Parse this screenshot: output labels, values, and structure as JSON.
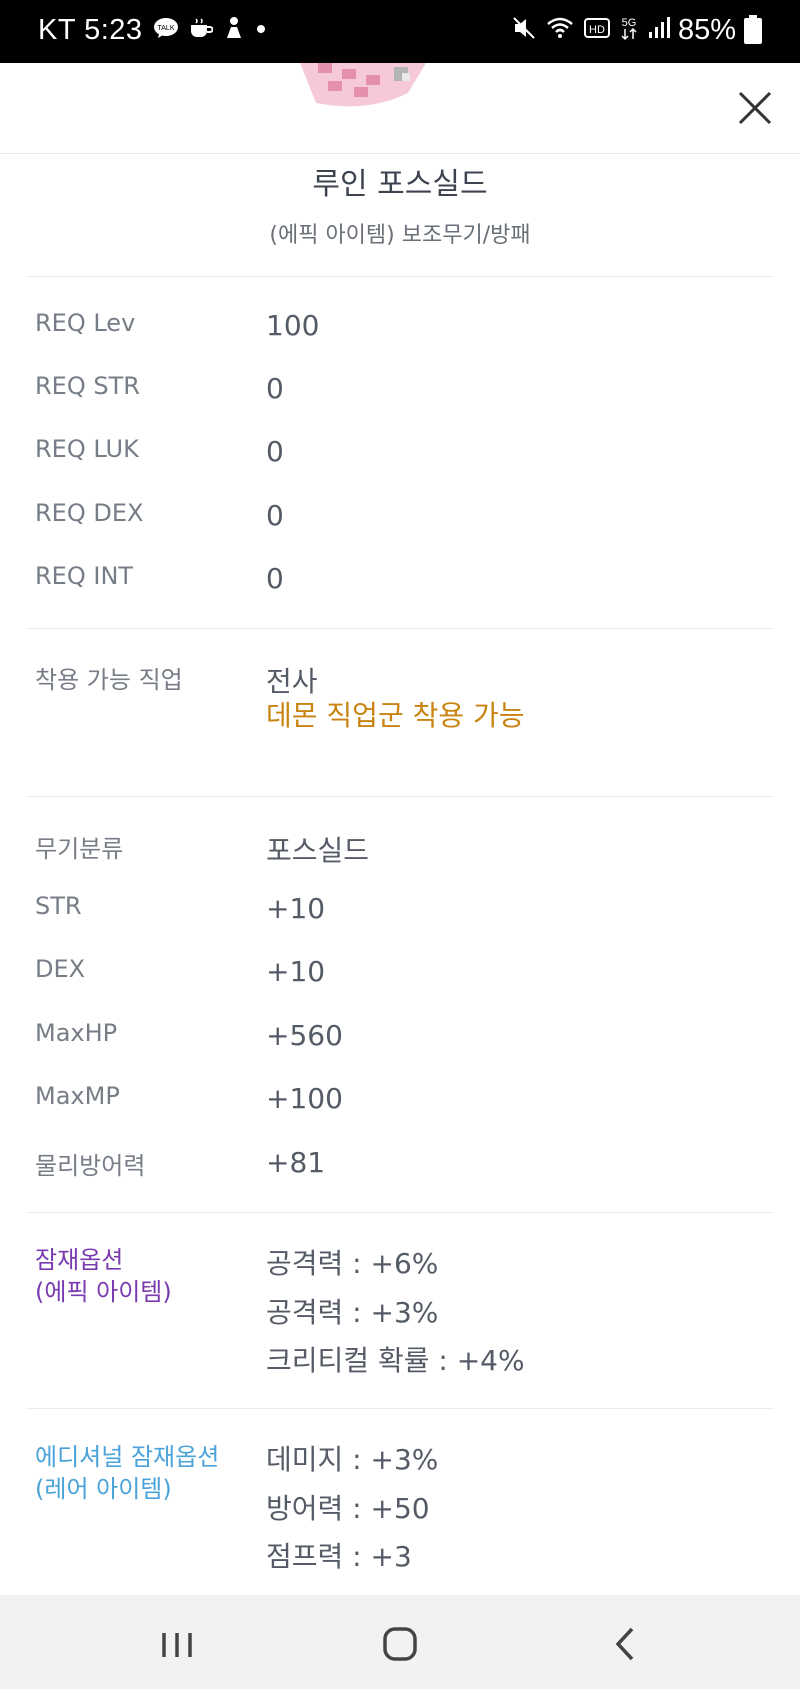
{
  "status_bar": {
    "carrier_time": "KT 5:23",
    "battery": "85%",
    "icons": [
      "talk-icon",
      "coffee-icon",
      "person-icon",
      "dot-icon",
      "mute-icon",
      "wifi-icon",
      "hd-icon",
      "5g-icon",
      "signal-icon",
      "battery-icon"
    ]
  },
  "header": {
    "close_icon": "close-icon"
  },
  "item": {
    "name": "루인 포스실드",
    "type": "(에픽 아이템) 보조무기/방패"
  },
  "requirements": [
    {
      "label": "REQ Lev",
      "value": "100"
    },
    {
      "label": "REQ STR",
      "value": "0"
    },
    {
      "label": "REQ LUK",
      "value": "0"
    },
    {
      "label": "REQ DEX",
      "value": "0"
    },
    {
      "label": "REQ INT",
      "value": "0"
    }
  ],
  "jobs": {
    "label": "착용 가능 직업",
    "value": "전사",
    "note": "데몬 직업군 착용 가능"
  },
  "stats": [
    {
      "label": "무기분류",
      "value": "포스실드"
    },
    {
      "label": "STR",
      "value": "+10"
    },
    {
      "label": "DEX",
      "value": "+10"
    },
    {
      "label": "MaxHP",
      "value": "+560"
    },
    {
      "label": "MaxMP",
      "value": "+100"
    },
    {
      "label": "물리방어력",
      "value": "+81"
    }
  ],
  "potential": {
    "label_line1": "잠재옵션",
    "label_line2": "(에픽 아이템)",
    "values": [
      "공격력 : +6%",
      "공격력 : +3%",
      "크리티컬 확률 : +4%"
    ],
    "color": "#7a3bb0"
  },
  "additional_potential": {
    "label_line1": "에디셔널 잠재옵션",
    "label_line2": "(레어 아이템)",
    "values": [
      "데미지 : +3%",
      "방어력 : +50",
      "점프력 : +3"
    ],
    "color": "#4ba3d9"
  },
  "colors": {
    "orange_note": "#c98310",
    "nav_bg": "#f2f2f2"
  }
}
